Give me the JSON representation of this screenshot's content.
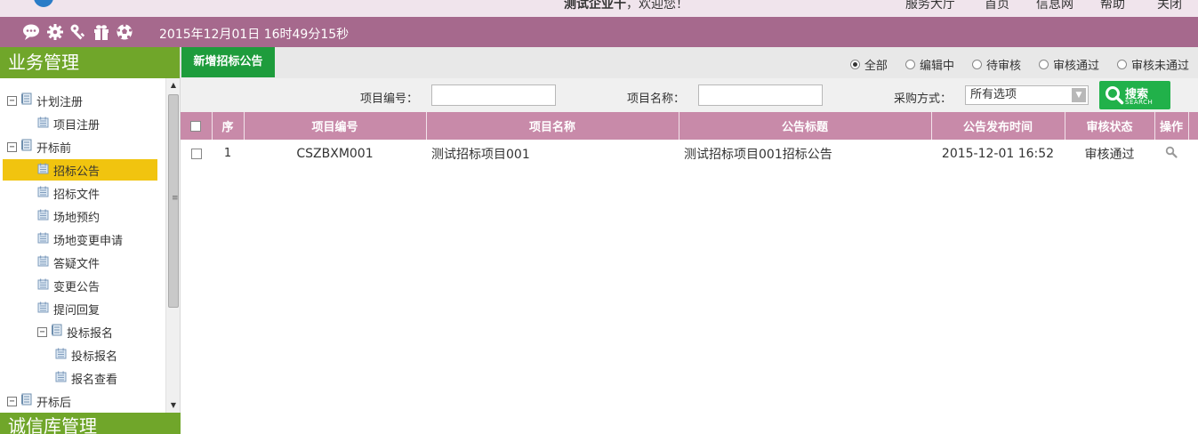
{
  "header": {
    "welcome_company": "测试企业十",
    "welcome_suffix": "，欢迎您！",
    "links": [
      "服务大厅",
      "首页",
      "信息网",
      "帮助",
      "关闭"
    ]
  },
  "topbar": {
    "datetime": "2015年12月01日 16时49分15秒",
    "icons": [
      "chat-icon",
      "gear-icon",
      "key-icon",
      "gift-icon",
      "football-icon"
    ]
  },
  "sidebar": {
    "title": "业务管理",
    "footer_title": "诚信库管理",
    "tree": [
      {
        "label": "计划注册",
        "type": "folder",
        "level": 0,
        "toggle": "⊟"
      },
      {
        "label": "项目注册",
        "type": "page",
        "level": 1
      },
      {
        "label": "开标前",
        "type": "folder",
        "level": 0,
        "toggle": "⊟"
      },
      {
        "label": "招标公告",
        "type": "page",
        "level": 1,
        "active": true
      },
      {
        "label": "招标文件",
        "type": "page",
        "level": 1
      },
      {
        "label": "场地预约",
        "type": "page",
        "level": 1
      },
      {
        "label": "场地变更申请",
        "type": "page",
        "level": 1
      },
      {
        "label": "答疑文件",
        "type": "page",
        "level": 1
      },
      {
        "label": "变更公告",
        "type": "page",
        "level": 1
      },
      {
        "label": "提问回复",
        "type": "page",
        "level": 1
      },
      {
        "label": "投标报名",
        "type": "folder",
        "level": 1,
        "toggle": "⊟"
      },
      {
        "label": "投标报名",
        "type": "page",
        "level": 2
      },
      {
        "label": "报名查看",
        "type": "page",
        "level": 2
      },
      {
        "label": "开标后",
        "type": "folder",
        "level": 0,
        "toggle": "⊟"
      }
    ]
  },
  "toolbar": {
    "add_label": "新增招标公告",
    "filters": [
      {
        "label": "全部",
        "checked": true
      },
      {
        "label": "编辑中",
        "checked": false
      },
      {
        "label": "待审核",
        "checked": false
      },
      {
        "label": "审核通过",
        "checked": false
      },
      {
        "label": "审核未通过",
        "checked": false
      }
    ]
  },
  "search": {
    "project_no_label": "项目编号：",
    "project_no_value": "",
    "project_name_label": "项目名称：",
    "project_name_value": "",
    "method_label": "采购方式：",
    "method_value": "所有选项",
    "button_label": "搜索",
    "button_sub": "SEARCH"
  },
  "table": {
    "columns": [
      "序",
      "项目编号",
      "项目名称",
      "公告标题",
      "公告发布时间",
      "审核状态",
      "操作"
    ],
    "rows": [
      {
        "seq": "1",
        "project_no": "CSZBXM001",
        "project_name": "测试招标项目001",
        "title": "测试招标项目001招标公告",
        "published": "2015-12-01 16:52",
        "status": "审核通过"
      }
    ]
  },
  "colors": {
    "header_purple": "#a6698d",
    "sidebar_green": "#70a62a",
    "active_yellow": "#f1c40f",
    "button_green": "#1e9c3c",
    "table_header": "#c88aa9"
  }
}
